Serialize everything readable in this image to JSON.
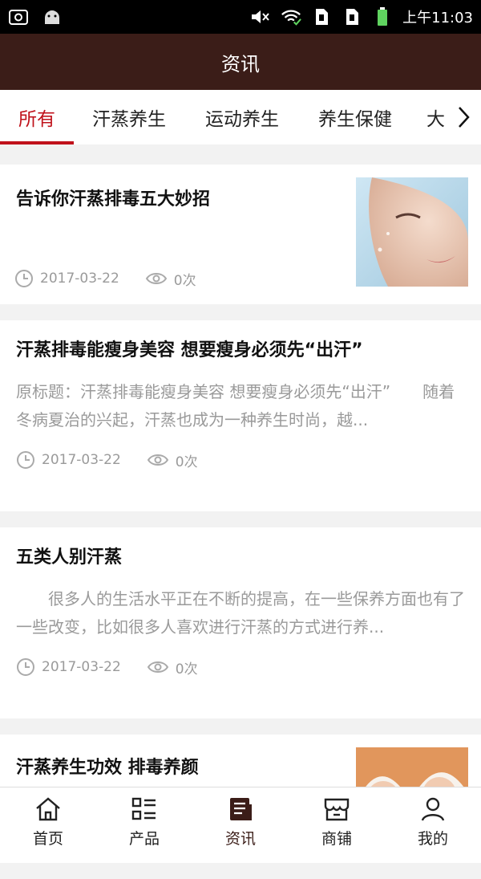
{
  "status_bar": {
    "time": "上午11:03",
    "icons": [
      "screenshot-icon",
      "android-icon",
      "mute-icon",
      "wifi-icon",
      "sim1-icon",
      "sim2-icon",
      "battery-icon"
    ]
  },
  "header": {
    "title": "资讯"
  },
  "tabs": [
    {
      "label": "所有",
      "active": true
    },
    {
      "label": "汗蒸养生"
    },
    {
      "label": "运动养生"
    },
    {
      "label": "养生保健"
    },
    {
      "label": "大"
    }
  ],
  "articles": [
    {
      "title": "告诉你汗蒸排毒五大妙招",
      "date": "2017-03-22",
      "views": "0次",
      "has_image": true
    },
    {
      "title": "汗蒸排毒能瘦身美容 想要瘦身必须先“出汗”",
      "summary": "原标题：汗蒸排毒能瘦身美容 想要瘦身必须先“出汗”　　随着冬病夏治的兴起，汗蒸也成为一种养生时尚，越...",
      "date": "2017-03-22",
      "views": "0次"
    },
    {
      "title": "五类人别汗蒸",
      "summary": "　　很多人的生活水平正在不断的提高，在一些保养方面也有了一些改变，比如很多人喜欢进行汗蒸的方式进行养...",
      "date": "2017-03-22",
      "views": "0次"
    },
    {
      "title": "汗蒸养生功效 排毒养颜",
      "has_image": true
    }
  ],
  "bottom_nav": [
    {
      "label": "首页",
      "icon": "home-icon"
    },
    {
      "label": "产品",
      "icon": "grid-list-icon"
    },
    {
      "label": "资讯",
      "icon": "news-icon",
      "active": true
    },
    {
      "label": "商铺",
      "icon": "shop-icon"
    },
    {
      "label": "我的",
      "icon": "user-icon"
    }
  ],
  "colors": {
    "header_bg": "#3b1d18",
    "accent": "#c0121b",
    "meta": "#9a9a9a"
  }
}
